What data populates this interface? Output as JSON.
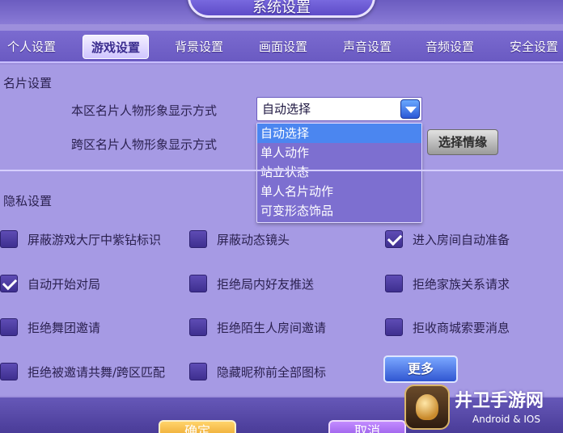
{
  "window": {
    "title": "系统设置"
  },
  "tabs": [
    {
      "label": "个人设置"
    },
    {
      "label": "游戏设置"
    },
    {
      "label": "背景设置"
    },
    {
      "label": "画面设置"
    },
    {
      "label": "声音设置"
    },
    {
      "label": "音频设置"
    },
    {
      "label": "安全设置"
    }
  ],
  "active_tab": "游戏设置",
  "card_section": {
    "title": "名片设置",
    "local_label": "本区名片人物形象显示方式",
    "cross_label": "跨区名片人物形象显示方式",
    "dropdown": {
      "value": "自动选择",
      "options": [
        "自动选择",
        "单人动作",
        "站立状态",
        "单人名片动作",
        "可变形态饰品"
      ],
      "selected_index": 0
    },
    "select_bond_button": "选择情缘"
  },
  "privacy_section": {
    "title": "隐私设置",
    "checkboxes": [
      {
        "label": "屏蔽游戏大厅中紫钻标识",
        "checked": false
      },
      {
        "label": "屏蔽动态镜头",
        "checked": false
      },
      {
        "label": "进入房间自动准备",
        "checked": true
      },
      {
        "label": "自动开始对局",
        "checked": true
      },
      {
        "label": "拒绝局内好友推送",
        "checked": false
      },
      {
        "label": "拒绝家族关系请求",
        "checked": false
      },
      {
        "label": "拒绝舞团邀请",
        "checked": false
      },
      {
        "label": "拒绝陌生人房间邀请",
        "checked": false
      },
      {
        "label": "拒收商城索要消息",
        "checked": false
      },
      {
        "label": "拒绝被邀请共舞/跨区匹配",
        "checked": false
      },
      {
        "label": "隐藏昵称前全部图标",
        "checked": false
      }
    ],
    "more_button": "更多"
  },
  "footer": {
    "confirm_label": "确定",
    "cancel_label": "取消"
  },
  "watermark": {
    "title": "井卫手游网",
    "subtitle": "Android & IOS"
  }
}
